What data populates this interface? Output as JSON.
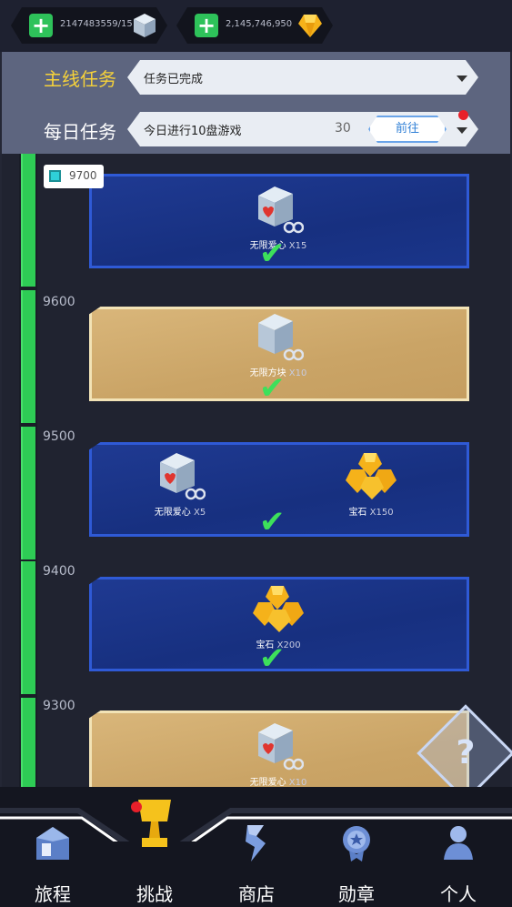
{
  "resources": [
    {
      "value": "2147483559/15",
      "icon": "cube-icon",
      "add_icon": "plus-icon"
    },
    {
      "value": "2,145,746,950",
      "icon": "gem-icon",
      "add_icon": "plus-icon"
    }
  ],
  "tasks": {
    "main": {
      "label": "主线任务",
      "value": "任务已完成"
    },
    "daily": {
      "label": "每日任务",
      "value": "今日进行10盘游戏",
      "count": "30",
      "goto_label": "前往"
    }
  },
  "progress_marker": {
    "value": "9700"
  },
  "levels": [
    {
      "label": "9700",
      "card": "blue",
      "rewards": [
        {
          "name": "无限爱心",
          "qty": "X15",
          "icon": "heart-cube-icon"
        }
      ],
      "claimed": true
    },
    {
      "label": "9600",
      "card": "gold",
      "rewards": [
        {
          "name": "无限方块",
          "qty": "X10",
          "icon": "cube-icon"
        }
      ],
      "claimed": true
    },
    {
      "label": "9500",
      "card": "blue",
      "rewards": [
        {
          "name": "无限爱心",
          "qty": "X5",
          "icon": "heart-cube-icon"
        },
        {
          "name": "宝石",
          "qty": "X150",
          "icon": "gem-icon"
        }
      ],
      "claimed": true
    },
    {
      "label": "9400",
      "card": "blue",
      "rewards": [
        {
          "name": "宝石",
          "qty": "X200",
          "icon": "gem-icon"
        }
      ],
      "claimed": true
    },
    {
      "label": "9300",
      "card": "gold",
      "rewards": [
        {
          "name": "无限爱心",
          "qty": "X10",
          "icon": "heart-cube-icon"
        }
      ],
      "claimed": false
    }
  ],
  "help": {
    "label": "?"
  },
  "nav": [
    {
      "label": "旅程",
      "icon": "house-icon"
    },
    {
      "label": "挑战",
      "icon": "trophy-icon",
      "active": true
    },
    {
      "label": "商店",
      "icon": "shop-icon"
    },
    {
      "label": "勋章",
      "icon": "medal-icon"
    },
    {
      "label": "个人",
      "icon": "person-icon"
    }
  ],
  "colors": {
    "accent_green": "#2ecc55",
    "main_task_label": "#f6d23a",
    "card_blue": "#1f3a92",
    "card_gold": "#d9b67a",
    "goto_text": "#2f7fd6",
    "notify_red": "#e8202a"
  }
}
